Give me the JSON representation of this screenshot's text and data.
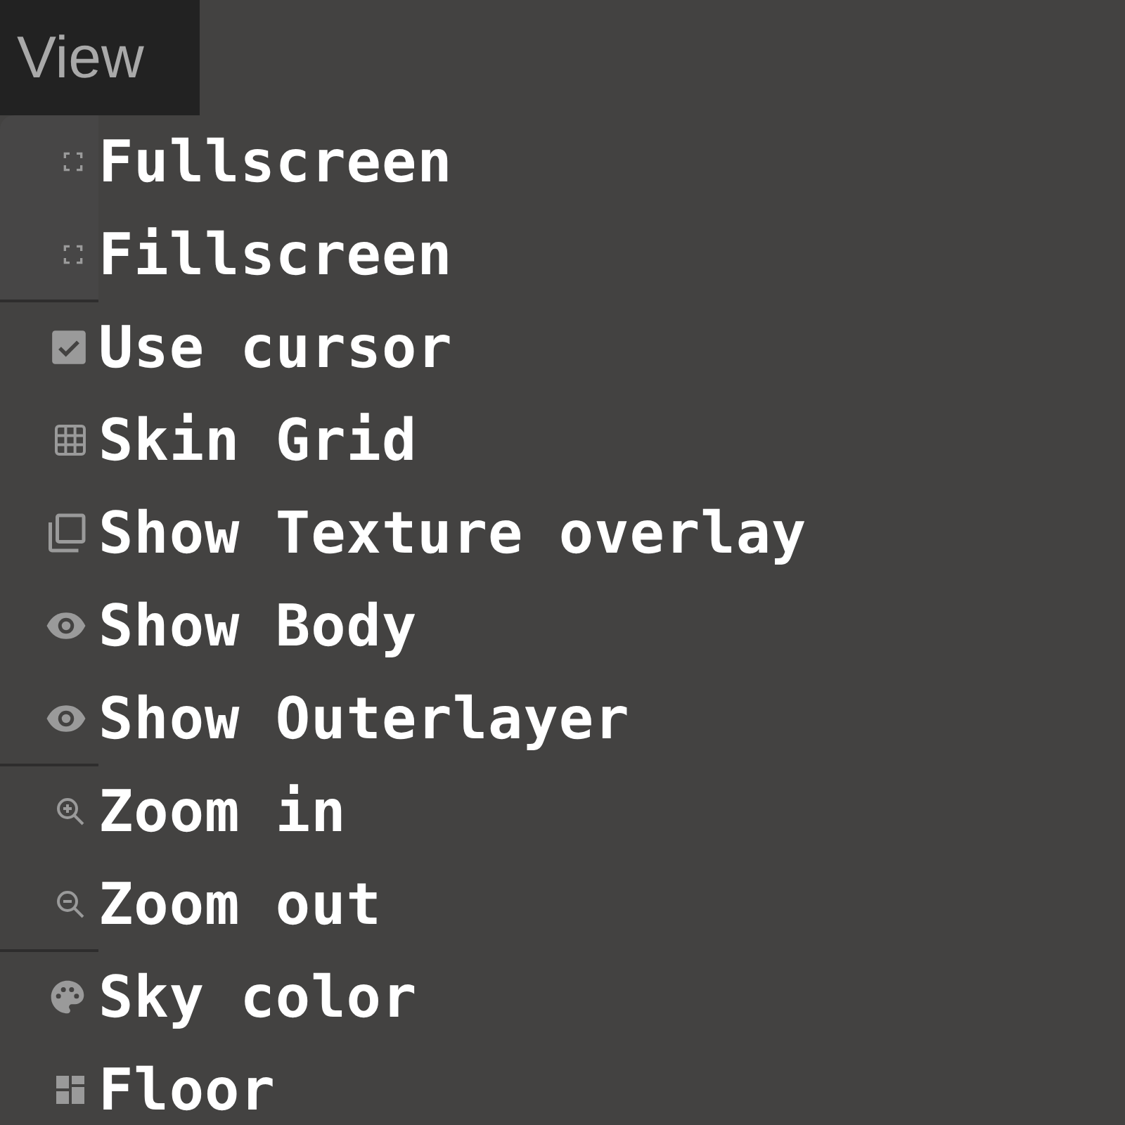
{
  "menu": {
    "title": "View"
  },
  "sections": [
    {
      "items": [
        {
          "label": "Fullscreen",
          "kind": "action"
        },
        {
          "label": "Fillscreen",
          "kind": "action"
        }
      ]
    },
    {
      "items": [
        {
          "label": "Use cursor",
          "kind": "checkbox",
          "checked": true
        },
        {
          "label": "Skin Grid",
          "kind": "action"
        },
        {
          "label": "Show Texture overlay",
          "kind": "action"
        },
        {
          "label": "Show Body",
          "kind": "action"
        },
        {
          "label": "Show Outerlayer",
          "kind": "action"
        }
      ]
    },
    {
      "items": [
        {
          "label": "Zoom in",
          "kind": "action"
        },
        {
          "label": "Zoom out",
          "kind": "action"
        }
      ]
    },
    {
      "items": [
        {
          "label": "Sky color",
          "kind": "action"
        },
        {
          "label": "Floor",
          "kind": "action"
        }
      ]
    }
  ]
}
